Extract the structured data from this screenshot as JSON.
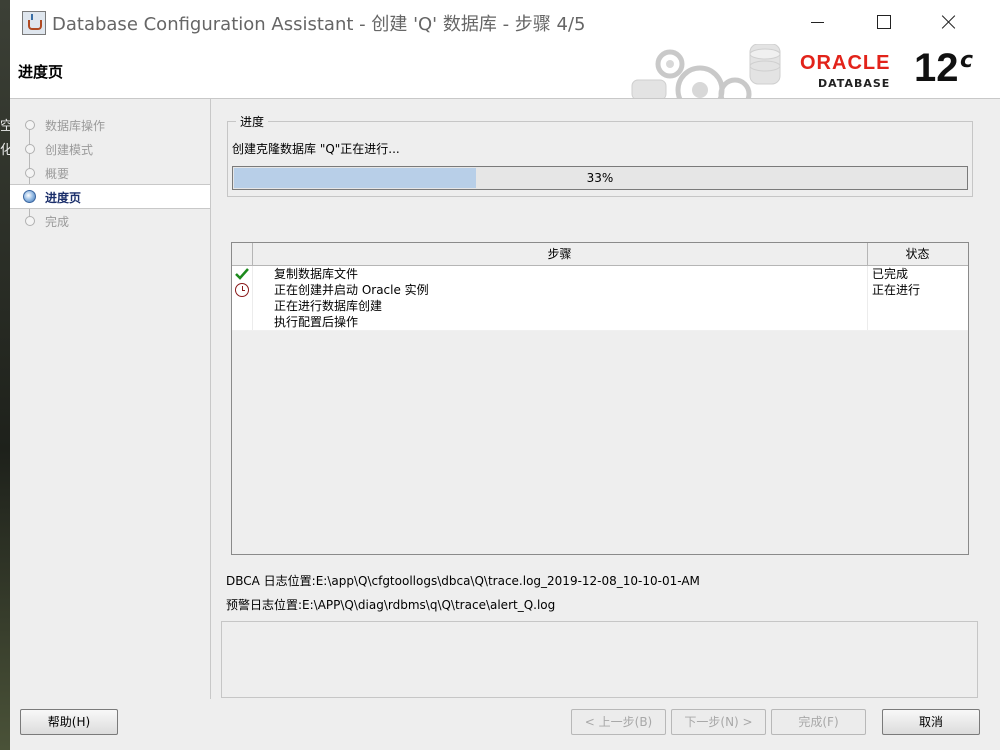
{
  "window": {
    "title": "Database Configuration Assistant - 创建 'Q' 数据库 - 步骤 4/5"
  },
  "header": {
    "title": "进度页",
    "brand": "ORACLE",
    "brand_sub": "DATABASE",
    "version": "12",
    "version_suffix": "c",
    "brand_color": "#e2231a"
  },
  "nav": {
    "items": [
      {
        "label": "数据库操作",
        "state": "done"
      },
      {
        "label": "创建模式",
        "state": "done"
      },
      {
        "label": "概要",
        "state": "done"
      },
      {
        "label": "进度页",
        "state": "active"
      },
      {
        "label": "完成",
        "state": "pending"
      }
    ]
  },
  "progress": {
    "group_title": "进度",
    "message": "创建克隆数据库 \"Q\"正在进行...",
    "percent_label": "33%",
    "percent": 33,
    "fill_color": "#b8cfe8"
  },
  "steps_table": {
    "headers": {
      "step": "步骤",
      "status": "状态"
    },
    "rows": [
      {
        "icon": "check-icon",
        "step": "复制数据库文件",
        "status": "已完成"
      },
      {
        "icon": "clock-icon",
        "step": "正在创建并启动 Oracle 实例",
        "status": "正在进行"
      },
      {
        "icon": "",
        "step": "正在进行数据库创建",
        "status": ""
      },
      {
        "icon": "",
        "step": "执行配置后操作",
        "status": ""
      }
    ]
  },
  "logs": {
    "dbca": "DBCA 日志位置:E:\\app\\Q\\cfgtoollogs\\dbca\\Q\\trace.log_2019-12-08_10-10-01-AM",
    "alert": "预警日志位置:E:\\APP\\Q\\diag\\rdbms\\q\\Q\\trace\\alert_Q.log"
  },
  "buttons": {
    "help": "帮助(H)",
    "back": "< 上一步(B)",
    "next": "下一步(N) >",
    "finish": "完成(F)",
    "cancel": "取消"
  },
  "desktop": {
    "chars": [
      "空",
      "化"
    ]
  }
}
